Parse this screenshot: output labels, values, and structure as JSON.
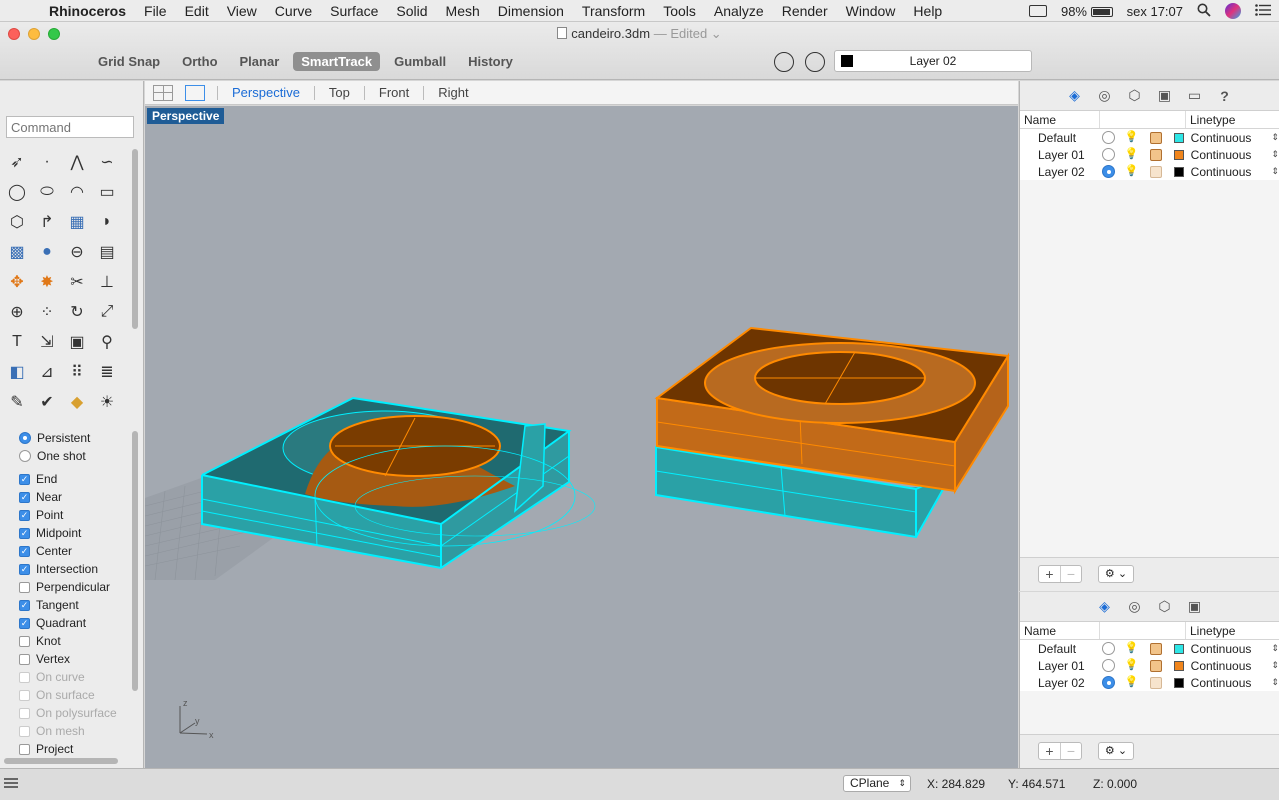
{
  "menubar": {
    "app_name": "Rhinoceros",
    "items": [
      "File",
      "Edit",
      "View",
      "Curve",
      "Surface",
      "Solid",
      "Mesh",
      "Dimension",
      "Transform",
      "Tools",
      "Analyze",
      "Render",
      "Window",
      "Help"
    ],
    "battery": "98%",
    "clock": "sex 17:07"
  },
  "window": {
    "doc_name": "candeiro.3dm",
    "doc_status": "— Edited"
  },
  "toolbar": {
    "modes": [
      {
        "label": "Grid Snap",
        "active": false
      },
      {
        "label": "Ortho",
        "active": false
      },
      {
        "label": "Planar",
        "active": false
      },
      {
        "label": "SmartTrack",
        "active": true
      },
      {
        "label": "Gumball",
        "active": false
      },
      {
        "label": "History",
        "active": false
      }
    ],
    "current_layer": "Layer 02"
  },
  "command": {
    "placeholder": "Command"
  },
  "tools": [
    "select-arrow-icon",
    "point-icon",
    "polyline-icon",
    "curve-icon",
    "circle-icon",
    "ellipse-icon",
    "arc-icon",
    "rectangle-icon",
    "polygon-icon",
    "fillet-curve-icon",
    "surface-icon",
    "sweep-icon",
    "box-icon",
    "sphere-icon",
    "cylinder-icon",
    "mesh-plane-icon",
    "transform-icon",
    "explode-icon",
    "trim-icon",
    "split-icon",
    "boolean-icon",
    "group-icon",
    "rotate-icon",
    "scale-icon",
    "text-icon",
    "dimension-icon",
    "array-icon",
    "analyze-icon",
    "solid-tools-icon",
    "project-icon",
    "grid-array-icon",
    "layer-tools-icon",
    "edit-icon",
    "check-icon",
    "render-icon",
    "light-icon"
  ],
  "osnap": {
    "mode": [
      {
        "label": "Persistent",
        "checked": true
      },
      {
        "label": "One shot",
        "checked": false
      }
    ],
    "items": [
      {
        "label": "End",
        "checked": true,
        "enabled": true
      },
      {
        "label": "Near",
        "checked": true,
        "enabled": true
      },
      {
        "label": "Point",
        "checked": true,
        "enabled": true
      },
      {
        "label": "Midpoint",
        "checked": true,
        "enabled": true
      },
      {
        "label": "Center",
        "checked": true,
        "enabled": true
      },
      {
        "label": "Intersection",
        "checked": true,
        "enabled": true
      },
      {
        "label": "Perpendicular",
        "checked": false,
        "enabled": true
      },
      {
        "label": "Tangent",
        "checked": true,
        "enabled": true
      },
      {
        "label": "Quadrant",
        "checked": true,
        "enabled": true
      },
      {
        "label": "Knot",
        "checked": false,
        "enabled": true
      },
      {
        "label": "Vertex",
        "checked": false,
        "enabled": true
      },
      {
        "label": "On curve",
        "checked": false,
        "enabled": false
      },
      {
        "label": "On surface",
        "checked": false,
        "enabled": false
      },
      {
        "label": "On polysurface",
        "checked": false,
        "enabled": false
      },
      {
        "label": "On mesh",
        "checked": false,
        "enabled": false
      },
      {
        "label": "Project",
        "checked": false,
        "enabled": true
      }
    ]
  },
  "viewtabs": {
    "tabs": [
      "Perspective",
      "Top",
      "Front",
      "Right"
    ],
    "active": "Perspective"
  },
  "viewport": {
    "label": "Perspective",
    "axes": {
      "z": "z",
      "y": "y",
      "x": "x"
    }
  },
  "layers_panel": {
    "col_name": "Name",
    "col_linetype": "Linetype",
    "rows": [
      {
        "name": "Default",
        "current": false,
        "on": true,
        "color": "#2ee6e6",
        "linetype": "Continuous"
      },
      {
        "name": "Layer 01",
        "current": false,
        "on": true,
        "color": "#f0851c",
        "linetype": "Continuous"
      },
      {
        "name": "Layer 02",
        "current": true,
        "on": false,
        "color": "#000000",
        "linetype": "Continuous"
      }
    ],
    "add_label": "+",
    "remove_label": "−",
    "gear_label": "⚙ ⌄"
  },
  "statusbar": {
    "cplane": "CPlane",
    "x": "X: 284.829",
    "y": "Y: 464.571",
    "z": "Z: 0.000"
  },
  "colors": {
    "selection_cyan": "#00f0ff",
    "selection_orange": "#ff8a00",
    "viewport_bg": "#a3a9b1",
    "accent_blue": "#1b6cd6"
  }
}
